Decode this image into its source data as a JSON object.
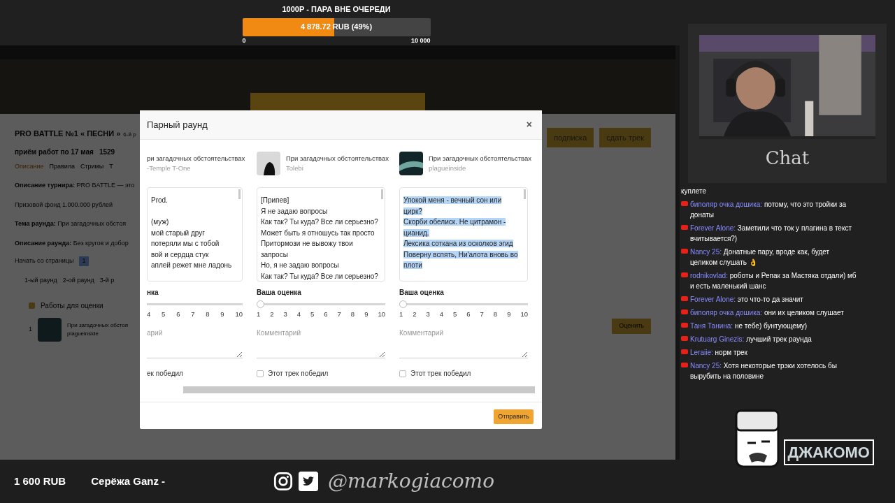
{
  "goal": {
    "title": "1000Р - ПАРА ВНЕ ОЧЕРЕДИ",
    "level": 0.49,
    "reading": "4 878.72 RUB (49%)",
    "min": "0",
    "max": "10 000"
  },
  "page": {
    "title": "PRO BATTLE №1 « ПЕСНИ »",
    "title_rest": "6-й р",
    "deadline": "приём работ по 17 мая",
    "count": "1529",
    "links": [
      "Описание",
      "Правила",
      "Стримы",
      "Т"
    ],
    "paragraphs": [
      "**Описание турнира:** PRO BATTLE — это",
      "Призовой фонд 1.000.000 рублей",
      "**Тема раунда:** При загадочных обстоя",
      "**Описание раунда:** Без кругов и добор"
    ],
    "start_label": "Начать со страницы",
    "start_value": "1",
    "rounds": [
      "1-ый раунд",
      "2-ой раунд",
      "3-й р"
    ],
    "works_title": "Работы для оценки",
    "work": {
      "number": "1",
      "title": "При загадочных обстоя",
      "artist": "plagueinside"
    },
    "subscribe": "подписка",
    "submit_track": "сдать трек",
    "rate": "Оценить"
  },
  "modal": {
    "title": "Парный раунд",
    "close": "×",
    "entries": [
      {
        "avatar": false,
        "title": "ри загадочных обстоятельствах",
        "artist": "-Temple T-One",
        "lyrics": [
          "Prod.",
          "(муж)",
          "мой старый друг",
          "потеряли мы с тобой",
          "вой и  сердца стук",
          "аплей режет мне ладонь"
        ],
        "selected_text": false,
        "rating_label": "нка",
        "scale": [
          "4",
          "5",
          "6",
          "7",
          "8",
          "9",
          "10"
        ],
        "comment_placeholder": "арий",
        "winner_label": "ек победил"
      },
      {
        "avatar": true,
        "title": "При загадочных обстоятельствах",
        "artist": "Tolebi",
        "lyrics": [
          "[Припев]",
          "Я не задаю вопросы",
          "Как так? Ты куда? Все ли серьезно?",
          "Может быть я отношусь так просто",
          "Притормози не вывожу твои",
          "запросы",
          "Но, я не задаю вопросы",
          "Как так? Ты куда? Все ли серьезно?"
        ],
        "selected_text": false,
        "rating_label": "Ваша оценка",
        "level": 0,
        "scale": [
          "1",
          "2",
          "3",
          "4",
          "5",
          "6",
          "7",
          "8",
          "9",
          "10"
        ],
        "comment_placeholder": "Комментарий",
        "winner_label": "Этот трек победил",
        "checked": false
      },
      {
        "avatar": true,
        "title": "При загадочных обстоятельствах",
        "artist": "plagueinside",
        "lyrics": [
          "Упокой меня - вечный сон или",
          "цирк?",
          "Скорби обелиск. Не цитрамон -",
          "цианид.",
          "Лексика соткана из осколков эгид",
          "Поверну вспять, Ни'алота вновь во",
          "плоти"
        ],
        "selected_text": true,
        "rating_label": "Ваша оценка",
        "level": 0,
        "scale": [
          "1",
          "2",
          "3",
          "4",
          "5",
          "6",
          "7",
          "8",
          "9",
          "10"
        ],
        "comment_placeholder": "Комментарий",
        "winner_label": "Этот трек победил",
        "checked": false
      }
    ],
    "send": "Отправить"
  },
  "chat": {
    "label": "Chat",
    "messages": [
      {
        "text": "куплете"
      },
      {
        "name": "биполяр очка дошика:",
        "text": "потому, что это тройки за донаты"
      },
      {
        "name": "Forever Alone:",
        "text": "Заметили что ток у плагина в текст вчитывается?)"
      },
      {
        "name": "Nancy 25:",
        "text": "Донатные пару, вроде как, будет целиком слушать",
        "emoji": "👌"
      },
      {
        "name": "rodnikovlad:",
        "text": "роботы и Репак за Мастяка отдали) мб и есть маленький шанс"
      },
      {
        "name": "Forever Alone:",
        "text": "это что-то да значит"
      },
      {
        "name": "биполяр очка дошика:",
        "text": "они их целиком слушает"
      },
      {
        "name": "Таня Танина:",
        "text": "не тебе) бунтующему)"
      },
      {
        "name": "Krutuarg Ginezis:",
        "text": "лучший трек раунда"
      },
      {
        "name": "Leraiie:",
        "text": "норм трек"
      },
      {
        "name": "Nancy 25:",
        "text": "Хотя некоторые трэки хотелось бы вырубить на половине"
      }
    ]
  },
  "bottom": {
    "amount": "1 600 RUB",
    "donor": "Серёжа Ganz -",
    "handle": "@markogiacomo",
    "logo": "ДЖАКОМО"
  }
}
